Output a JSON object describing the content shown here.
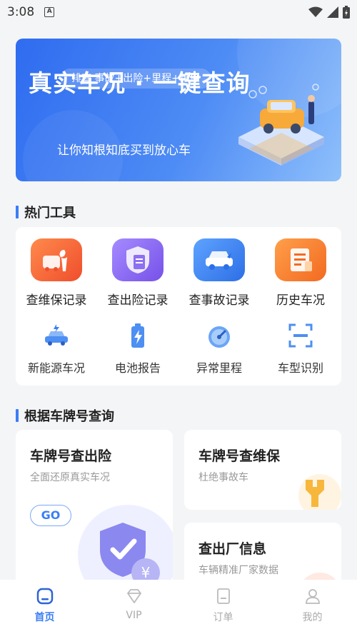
{
  "status": {
    "time": "3:08",
    "notif_glyph": "A"
  },
  "banner": {
    "title": "真实车况 · 一键查询",
    "pill": "排查 事故+出险+里程+维保",
    "subtitle": "让你知根知底买到放心车"
  },
  "hot_tools": {
    "heading": "热门工具",
    "primary": [
      {
        "label": "查维保记录",
        "icon": "car-wrench-icon",
        "color": "#f36a3c"
      },
      {
        "label": "查出险记录",
        "icon": "shield-doc-icon",
        "color": "#8a6cf0"
      },
      {
        "label": "查事故记录",
        "icon": "car-crash-icon",
        "color": "#3c86f0"
      },
      {
        "label": "历史车况",
        "icon": "history-doc-icon",
        "color": "#f5833a"
      }
    ],
    "secondary": [
      {
        "label": "新能源车况",
        "icon": "ev-car-icon"
      },
      {
        "label": "电池报告",
        "icon": "battery-icon"
      },
      {
        "label": "异常里程",
        "icon": "odometer-icon"
      },
      {
        "label": "车型识别",
        "icon": "scan-icon"
      }
    ]
  },
  "plate_query": {
    "heading": "根据车牌号查询",
    "insurance": {
      "title": "车牌号查出险",
      "subtitle": "全面还原真实车况",
      "go": "GO"
    },
    "maintenance": {
      "title": "车牌号查维保",
      "subtitle": "杜绝事故车"
    },
    "factory": {
      "title": "查出厂信息",
      "subtitle": "车辆精准厂家数据"
    }
  },
  "tabbar": {
    "items": [
      {
        "label": "首页",
        "icon": "home-icon",
        "active": true
      },
      {
        "label": "VIP",
        "icon": "diamond-icon",
        "active": false
      },
      {
        "label": "订单",
        "icon": "order-icon",
        "active": false
      },
      {
        "label": "我的",
        "icon": "user-icon",
        "active": false
      }
    ]
  },
  "colors": {
    "accent": "#3a7ef5",
    "background": "#f4f5f7"
  }
}
